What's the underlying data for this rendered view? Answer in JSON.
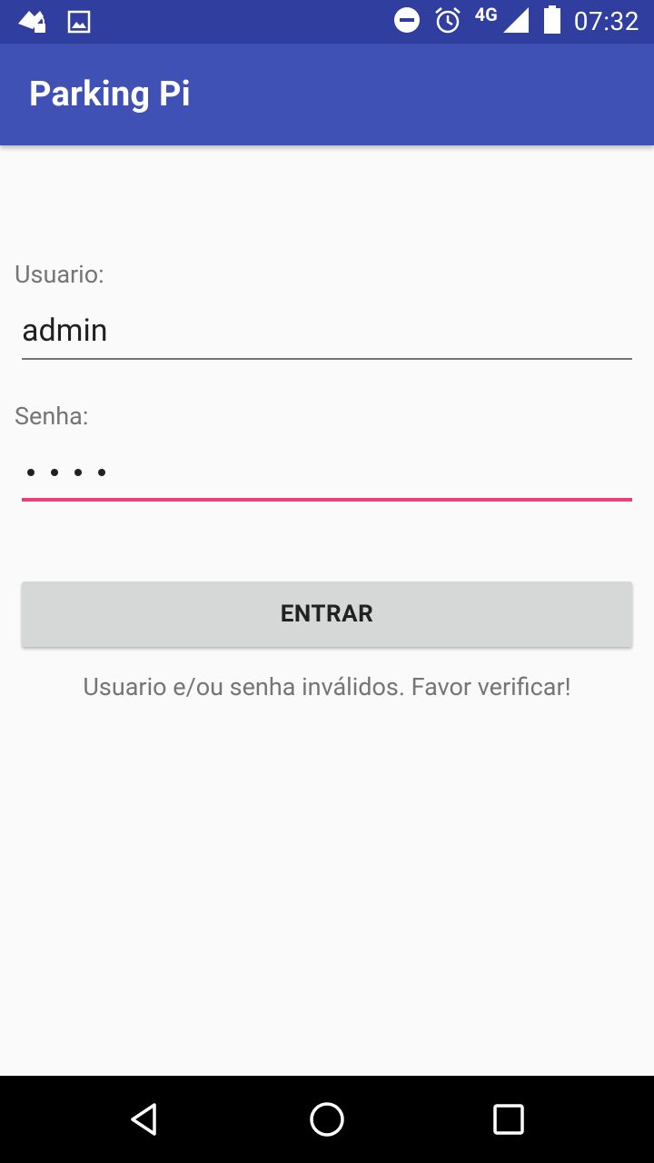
{
  "status_bar": {
    "time": "07:32",
    "network": "4G",
    "icons": [
      "vpn-lock-icon",
      "image-icon",
      "do-not-disturb-icon",
      "alarm-icon",
      "signal-icon",
      "battery-icon"
    ]
  },
  "app_bar": {
    "title": "Parking Pi"
  },
  "form": {
    "user_label": "Usuario:",
    "user_value": "admin",
    "password_label": "Senha:",
    "password_length": 4,
    "submit_label": "ENTRAR",
    "error_message": "Usuario e/ou senha inválidos. Favor verificar!"
  },
  "colors": {
    "primary": "#3f51b5",
    "primary_dark": "#303f9f",
    "accent": "#e9407a",
    "button": "#d6d7d7"
  },
  "nav_bar": {
    "icons": [
      "back-icon",
      "home-icon",
      "recents-icon"
    ]
  }
}
